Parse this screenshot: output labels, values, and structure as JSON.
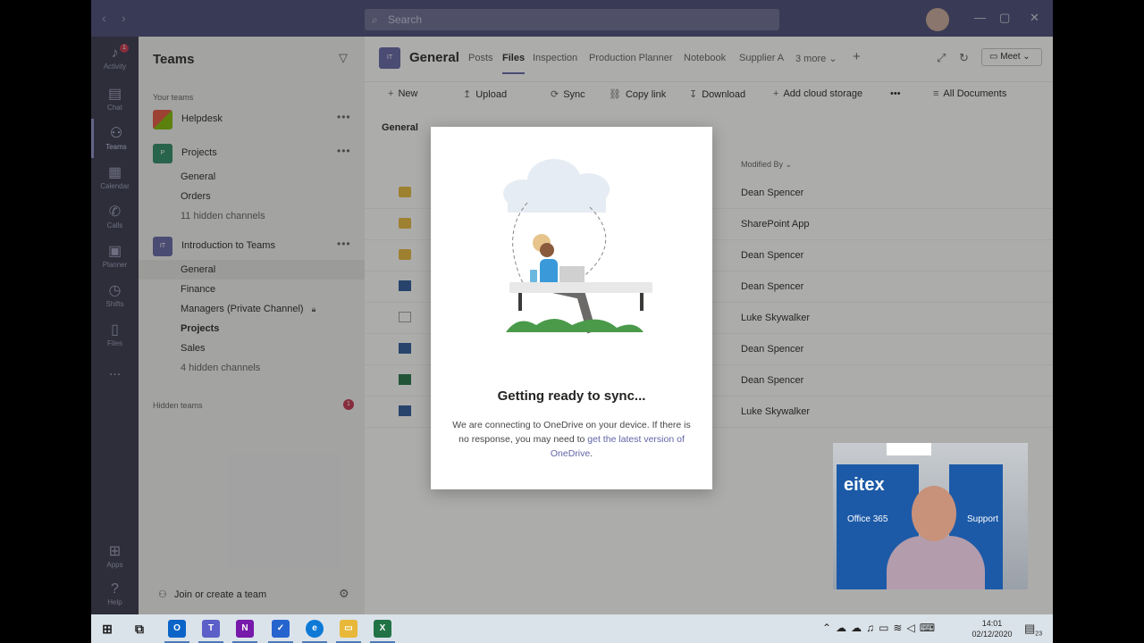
{
  "titlebar": {
    "search_placeholder": "Search"
  },
  "rail": [
    {
      "label": "Activity",
      "icon": "bell-icon",
      "badge": "1"
    },
    {
      "label": "Chat",
      "icon": "chat-icon"
    },
    {
      "label": "Teams",
      "icon": "teams-icon",
      "active": true
    },
    {
      "label": "Calendar",
      "icon": "calendar-icon"
    },
    {
      "label": "Calls",
      "icon": "phone-icon"
    },
    {
      "label": "Planner",
      "icon": "planner-icon"
    },
    {
      "label": "Shifts",
      "icon": "shifts-icon"
    },
    {
      "label": "Files",
      "icon": "file-icon"
    },
    {
      "label": "...",
      "icon": "more-icon"
    },
    {
      "label": "Apps",
      "icon": "apps-icon"
    },
    {
      "label": "Help",
      "icon": "help-icon"
    }
  ],
  "sidebar": {
    "title": "Teams",
    "your_teams_label": "Your teams",
    "teams": [
      {
        "name": "Helpdesk",
        "tile_color": "#e4553e"
      },
      {
        "name": "Projects",
        "tile_text": "P",
        "tile_color": "#2a8a66",
        "channels": [
          "General",
          "Orders",
          "11 hidden channels"
        ]
      },
      {
        "name": "Introduction to Teams",
        "tile_text": "IT",
        "tile_color": "#6264a7",
        "channels": [
          "General",
          "Finance",
          "Managers (Private Channel)",
          "Projects",
          "Sales",
          "4 hidden channels"
        ]
      }
    ],
    "hidden_teams_label": "Hidden teams",
    "hidden_teams_badge": "1",
    "join_label": "Join or create a team"
  },
  "channel_header": {
    "tile_text": "IT",
    "title": "General",
    "tabs": [
      "Posts",
      "Files",
      "Inspection",
      "Production Planner",
      "Notebook",
      "Supplier A",
      "3 more"
    ],
    "meet_label": "Meet"
  },
  "command_bar": {
    "new": "New",
    "upload": "Upload",
    "sync": "Sync",
    "copy_link": "Copy link",
    "download": "Download",
    "add_cloud": "Add cloud storage",
    "view": "All Documents"
  },
  "files": {
    "breadcrumb": "General",
    "modified_by_header": "Modified By",
    "rows": [
      {
        "type": "folder",
        "modified_by": "Dean Spencer"
      },
      {
        "type": "folder",
        "modified_by": "SharePoint App"
      },
      {
        "type": "folder",
        "modified_by": "Dean Spencer"
      },
      {
        "type": "word",
        "modified_by": "Dean Spencer"
      },
      {
        "type": "doc",
        "modified_by": "Luke Skywalker"
      },
      {
        "type": "word",
        "modified_by": "Dean Spencer"
      },
      {
        "type": "excel",
        "modified_by": "Dean Spencer"
      },
      {
        "type": "word",
        "modified_by": "Luke Skywalker"
      }
    ]
  },
  "dialog": {
    "title": "Getting ready to sync...",
    "body": "We are connecting to OneDrive on your device. If there is no response, you may need to ",
    "link": "get the latest version of OneDrive",
    "body_end": "."
  },
  "taskbar": {
    "apps": [
      {
        "name": "windows-start",
        "letter": "⊞",
        "color": "#1e1e1e"
      },
      {
        "name": "task-view",
        "letter": "⧉",
        "color": "#1e1e1e"
      },
      {
        "name": "outlook",
        "letter": "O",
        "color": "#0a64c8"
      },
      {
        "name": "teams",
        "letter": "T",
        "color": "#5b5fc7"
      },
      {
        "name": "onenote",
        "letter": "N",
        "color": "#7719aa"
      },
      {
        "name": "todo",
        "letter": "✓",
        "color": "#2564cf"
      },
      {
        "name": "edge",
        "letter": "e",
        "color": "#0c7ad6"
      },
      {
        "name": "file-explorer",
        "letter": "▭",
        "color": "#e8b83a"
      },
      {
        "name": "excel",
        "letter": "X",
        "color": "#217346"
      }
    ],
    "time": "14:01",
    "date": "02/12/2020",
    "notif_count": "23"
  },
  "webcam": {
    "brand": "eitex",
    "product": "Office 365",
    "support": "Support"
  }
}
